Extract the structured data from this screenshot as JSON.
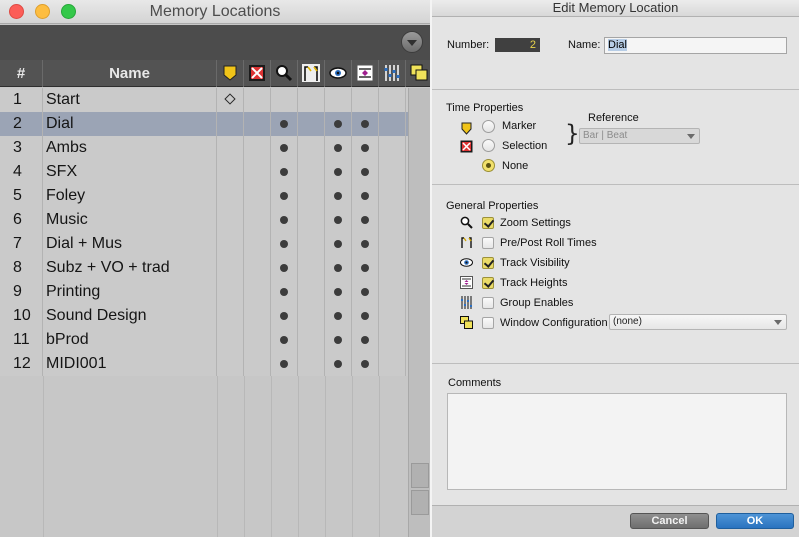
{
  "memory_locations": {
    "title": "Memory Locations",
    "columns": {
      "number": "#",
      "name": "Name"
    },
    "header_icons": [
      "marker-icon",
      "selection-icon",
      "zoom-icon",
      "pre-post-roll-icon",
      "track-visibility-icon",
      "track-heights-icon",
      "group-enables-icon",
      "window-config-icon"
    ],
    "rows": [
      {
        "num": "1",
        "name": "Start",
        "marker": true,
        "zoom": false,
        "vis": false,
        "heights": false,
        "selected": false
      },
      {
        "num": "2",
        "name": "Dial",
        "marker": false,
        "zoom": true,
        "vis": true,
        "heights": true,
        "selected": true
      },
      {
        "num": "3",
        "name": "Ambs",
        "marker": false,
        "zoom": true,
        "vis": true,
        "heights": true,
        "selected": false
      },
      {
        "num": "4",
        "name": "SFX",
        "marker": false,
        "zoom": true,
        "vis": true,
        "heights": true,
        "selected": false
      },
      {
        "num": "5",
        "name": "Foley",
        "marker": false,
        "zoom": true,
        "vis": true,
        "heights": true,
        "selected": false
      },
      {
        "num": "6",
        "name": "Music",
        "marker": false,
        "zoom": true,
        "vis": true,
        "heights": true,
        "selected": false
      },
      {
        "num": "7",
        "name": "Dial + Mus",
        "marker": false,
        "zoom": true,
        "vis": true,
        "heights": true,
        "selected": false
      },
      {
        "num": "8",
        "name": "Subz + VO + trad",
        "marker": false,
        "zoom": true,
        "vis": true,
        "heights": true,
        "selected": false
      },
      {
        "num": "9",
        "name": "Printing",
        "marker": false,
        "zoom": true,
        "vis": true,
        "heights": true,
        "selected": false
      },
      {
        "num": "10",
        "name": "Sound Design",
        "marker": false,
        "zoom": true,
        "vis": true,
        "heights": true,
        "selected": false
      },
      {
        "num": "11",
        "name": "bProd",
        "marker": false,
        "zoom": true,
        "vis": true,
        "heights": true,
        "selected": false
      },
      {
        "num": "12",
        "name": "MIDI001",
        "marker": false,
        "zoom": true,
        "vis": true,
        "heights": true,
        "selected": false
      }
    ]
  },
  "edit_location": {
    "title": "Edit Memory Location",
    "number_label": "Number:",
    "number_value": "2",
    "name_label": "Name:",
    "name_value": "Dial",
    "time_properties": {
      "heading": "Time Properties",
      "reference_label": "Reference",
      "reference_value": "Bar | Beat",
      "options": [
        {
          "label": "Marker",
          "selected": false
        },
        {
          "label": "Selection",
          "selected": false
        },
        {
          "label": "None",
          "selected": true
        }
      ]
    },
    "general_properties": {
      "heading": "General Properties",
      "items": [
        {
          "label": "Zoom Settings",
          "checked": true,
          "icon": "zoom-icon"
        },
        {
          "label": "Pre/Post Roll Times",
          "checked": false,
          "icon": "pre-post-roll-icon"
        },
        {
          "label": "Track Visibility",
          "checked": true,
          "icon": "track-visibility-icon"
        },
        {
          "label": "Track Heights",
          "checked": true,
          "icon": "track-heights-icon"
        },
        {
          "label": "Group Enables",
          "checked": false,
          "icon": "group-enables-icon"
        },
        {
          "label": "Window Configuration",
          "checked": false,
          "icon": "window-config-icon"
        }
      ],
      "window_config_value": "(none)"
    },
    "comments_label": "Comments",
    "comments_value": "",
    "cancel_label": "Cancel",
    "ok_label": "OK"
  },
  "colors": {
    "selected_row": "#9ba4b5",
    "ok_button": "#2a73bf",
    "check_yellow": "#eadb68"
  }
}
